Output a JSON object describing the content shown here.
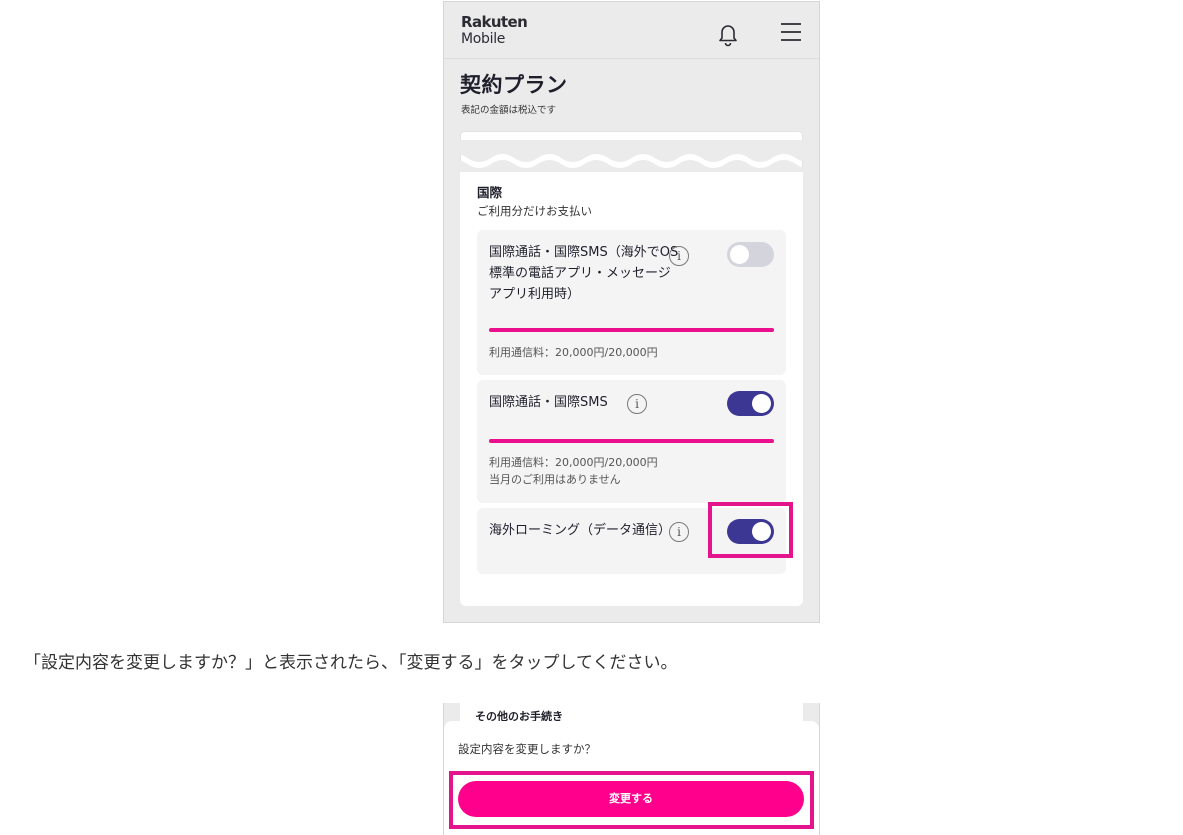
{
  "app": {
    "brand_line1": "Rakuten",
    "brand_line2": "Mobile"
  },
  "header": {
    "icons": [
      "bell-icon",
      "menu-icon"
    ]
  },
  "page": {
    "title": "契約プラン",
    "subtitle": "表記の金額は税込です"
  },
  "section": {
    "title": "国際",
    "subtitle": "ご利用分だけお支払い",
    "options": [
      {
        "label": "国際通話・国際SMS（海外でOS標準の電話アプリ・メッセージアプリ利用時）",
        "enabled": false,
        "usage_line1": "利用通信料：20,000円/20,000円",
        "usage_line2": ""
      },
      {
        "label": "国際通話・国際SMS",
        "enabled": true,
        "usage_line1": "利用通信料：20,000円/20,000円",
        "usage_line2": "当月のご利用はありません"
      },
      {
        "label": "海外ローミング（データ通信）",
        "enabled": true,
        "usage_line1": "",
        "usage_line2": ""
      }
    ]
  },
  "instruction": "「設定内容を変更しますか？」と表示されたら、「変更する」をタップしてください。",
  "dialog": {
    "behind_heading": "その他のお手続き",
    "question": "設定内容を変更しますか？",
    "confirm_label": "変更する"
  },
  "colors": {
    "accent": "#eb0e8d",
    "toggle_on": "#3c3793",
    "toggle_off": "#d4d4dc",
    "cta": "#ff008c",
    "highlight": "#e4148c"
  }
}
